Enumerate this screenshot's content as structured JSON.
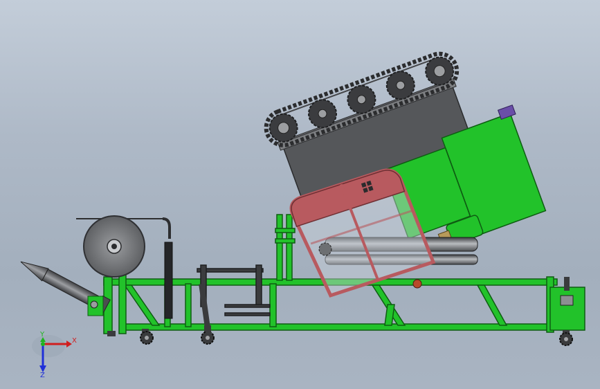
{
  "triad": {
    "x_label": "X",
    "y_label": "Y",
    "z_label": "Z",
    "x_color": "#d01e1e",
    "y_color": "#1fb51f",
    "z_color": "#1f2fd8"
  },
  "colors": {
    "frame_green": "#22c22a",
    "frame_stroke": "#0e5c12",
    "cab_red": "#b85a5f",
    "hopper_gray": "#5a5c5f",
    "roller_gray": "#6b6d70",
    "purple_motor": "#6a4ea8"
  }
}
